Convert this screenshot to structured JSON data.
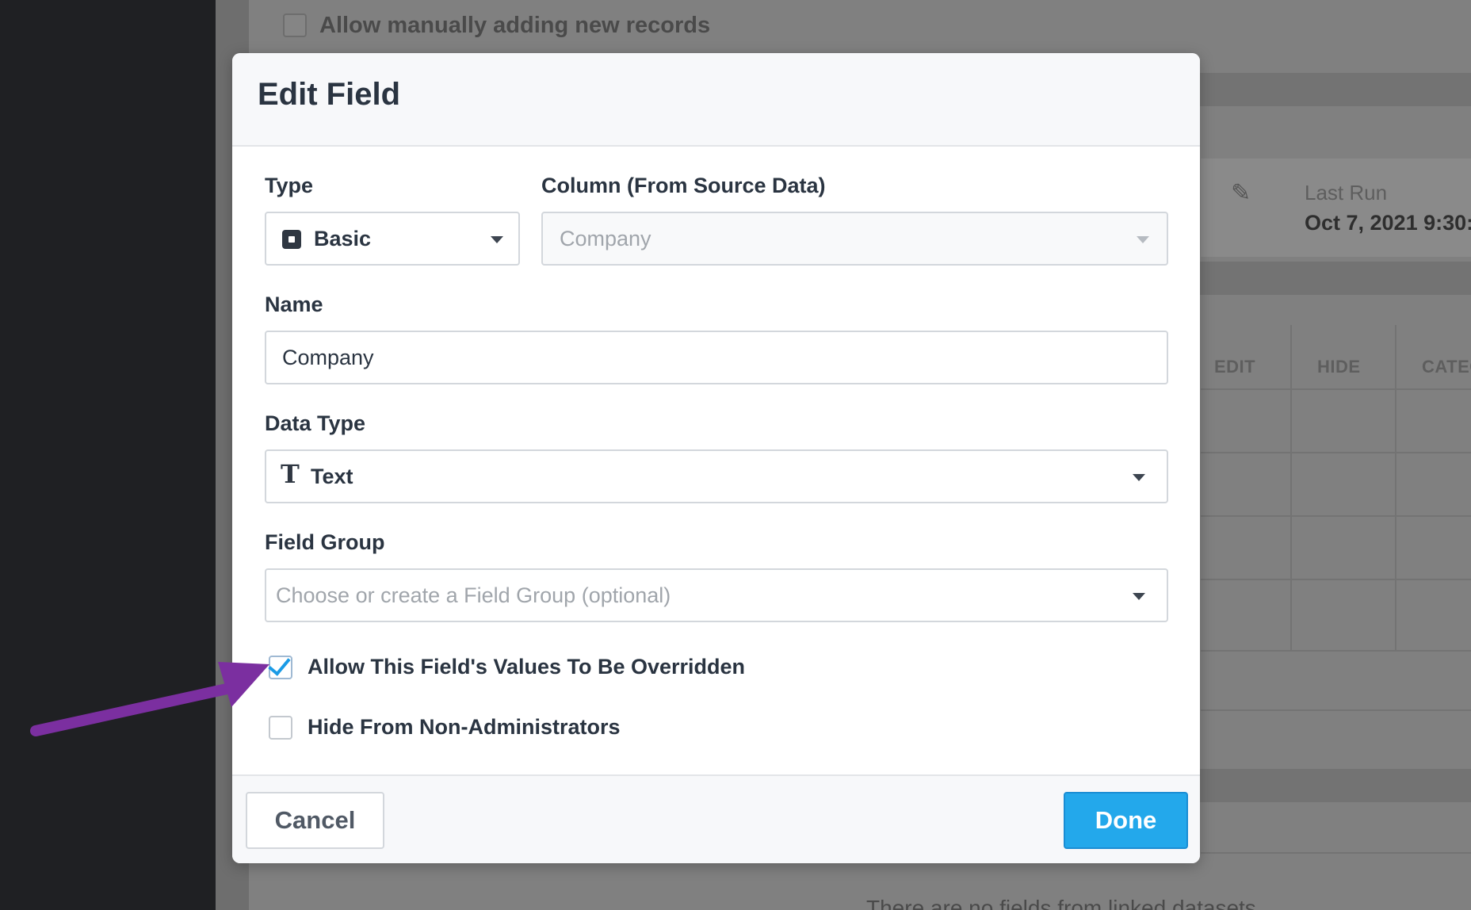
{
  "background": {
    "checkbox_label": "Allow manually adding new records",
    "last_run_label": "Last Run",
    "last_run_value": "Oct 7, 2021 9:30:",
    "columns": [
      "EDIT",
      "HIDE",
      "CATEG"
    ],
    "footnote": "There are no fields from linked datasets"
  },
  "modal": {
    "title": "Edit Field",
    "type": {
      "label": "Type",
      "value": "Basic"
    },
    "column": {
      "label": "Column (From Source Data)",
      "value": "Company"
    },
    "name": {
      "label": "Name",
      "value": "Company"
    },
    "data_type": {
      "label": "Data Type",
      "value": "Text"
    },
    "field_group": {
      "label": "Field Group",
      "placeholder": "Choose or create a Field Group (optional)"
    },
    "checkboxes": [
      {
        "label": "Allow This Field's Values To Be Overridden",
        "checked": true
      },
      {
        "label": "Hide From Non-Administrators",
        "checked": false
      }
    ],
    "footer": {
      "cancel_label": "Cancel",
      "done_label": "Done"
    }
  },
  "colors": {
    "accent": "#23a8eb",
    "annotation_arrow": "#7b2fa0",
    "nav_bg": "#1f2023"
  }
}
